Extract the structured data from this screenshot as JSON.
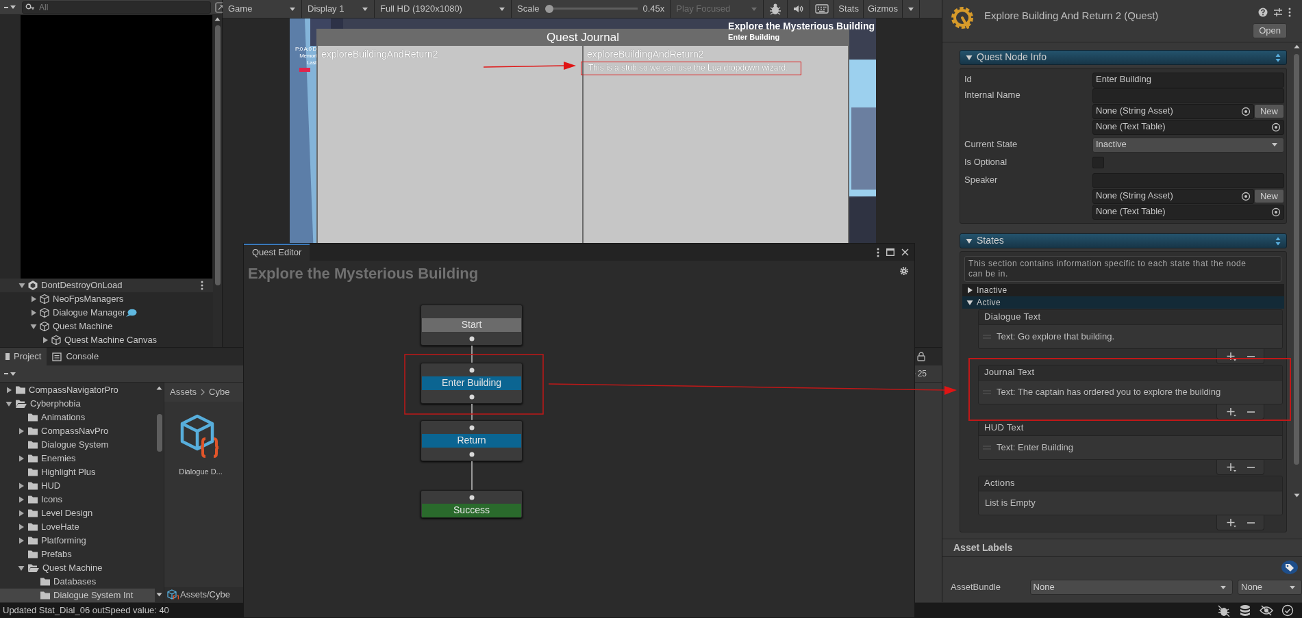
{
  "hierarchy": {
    "search_placeholder": "All",
    "items": [
      {
        "label": "DontDestroyOnLoad",
        "kind": "scene",
        "expanded": true,
        "children": [
          {
            "label": "NeoFpsManagers",
            "kind": "object",
            "expanded": false
          },
          {
            "label": "Dialogue Manager",
            "kind": "dialogue_object",
            "expanded": false
          },
          {
            "label": "Quest Machine",
            "kind": "object",
            "expanded": true,
            "children": [
              {
                "label": "Quest Machine Canvas",
                "kind": "object",
                "expanded": false
              }
            ]
          }
        ]
      }
    ]
  },
  "game_toolbar": {
    "view": "Game",
    "display": "Display 1",
    "resolution": "Full HD (1920x1080)",
    "scale_label": "Scale",
    "scale": {
      "level": 0
    },
    "scale_value": "0.45x",
    "play_mode": "Play Focused",
    "stats": "Stats",
    "gizmos": "Gizmos"
  },
  "game_view": {
    "hud_lines": [
      "P:0 A:0 D",
      "Memori",
      "Last"
    ],
    "tracker_title": "Explore the Mysterious Building",
    "tracker_objective": "Enter Building",
    "journal": {
      "title": "Quest Journal",
      "quests": [
        "exploreBuildingAndReturn2"
      ],
      "detail_heading": "exploreBuildingAndReturn2",
      "detail_text": "This is a stub so we can use the Lua dropdown wizard."
    }
  },
  "project": {
    "tabs": [
      {
        "label": "Project",
        "selected": true
      },
      {
        "label": "Console",
        "selected": false
      }
    ],
    "item_count": "25",
    "folders": [
      {
        "label": "CompassNavigatorPro",
        "expanded": false,
        "selected": false
      },
      {
        "label": "Cyberphobia",
        "expanded": true,
        "selected": false,
        "children": [
          {
            "label": "Animations",
            "selected": false
          },
          {
            "label": "CompassNavPro",
            "expanded": false,
            "selected": false
          },
          {
            "label": "Dialogue System",
            "selected": false
          },
          {
            "label": "Enemies",
            "expanded": false,
            "selected": false
          },
          {
            "label": "Highlight Plus",
            "selected": false
          },
          {
            "label": "HUD",
            "expanded": false,
            "selected": false
          },
          {
            "label": "Icons",
            "expanded": false,
            "selected": false
          },
          {
            "label": "Level Design",
            "expanded": false,
            "selected": false
          },
          {
            "label": "LoveHate",
            "expanded": false,
            "selected": false
          },
          {
            "label": "Platforming",
            "expanded": false,
            "selected": false
          },
          {
            "label": "Prefabs",
            "selected": false
          },
          {
            "label": "Quest Machine",
            "expanded": true,
            "selected": false,
            "children": [
              {
                "label": "Databases",
                "selected": false
              },
              {
                "label": "Dialogue System Int",
                "selected": true
              }
            ]
          }
        ]
      }
    ],
    "breadcrumb": [
      "Assets",
      "Cybe"
    ],
    "assets": [
      {
        "label": "Dialogue D..."
      }
    ],
    "selected_path": "Assets/Cybe"
  },
  "quest_editor": {
    "tab": "Quest Editor",
    "title": "Explore the Mysterious Building",
    "nodes": [
      {
        "label": "Start",
        "kind": "start"
      },
      {
        "label": "Enter Building",
        "kind": "active"
      },
      {
        "label": "Return",
        "kind": "active"
      },
      {
        "label": "Success",
        "kind": "success"
      }
    ]
  },
  "inspector": {
    "title": "Explore Building And Return 2 (Quest)",
    "open_button": "Open",
    "node_info": {
      "heading": "Quest Node Info",
      "expanded": true,
      "fields": [
        {
          "kind": "text",
          "label": "Id",
          "value": "Enter Building"
        },
        {
          "kind": "string_field",
          "label": "Internal Name",
          "string_asset": "None (String Asset)",
          "new_button": "New",
          "text_table": "None (Text Table)"
        },
        {
          "kind": "dropdown",
          "label": "Current State",
          "value": "Inactive"
        },
        {
          "kind": "checkbox",
          "label": "Is Optional",
          "checked": false
        },
        {
          "kind": "string_field",
          "label": "Speaker",
          "string_asset": "None (String Asset)",
          "new_button": "New",
          "text_table": "None (Text Table)"
        }
      ]
    },
    "states": {
      "heading": "States",
      "expanded": true,
      "help": "This section contains information specific to each state that the node can be in.",
      "foldouts": [
        {
          "label": "Inactive",
          "expanded": false
        },
        {
          "label": "Active",
          "expanded": true,
          "lists": [
            {
              "heading": "Dialogue Text",
              "items": [
                "Text: Go explore that building."
              ]
            },
            {
              "heading": "Journal Text",
              "items": [
                "Text: The captain has ordered you to explore the building"
              ]
            },
            {
              "heading": "HUD Text",
              "items": [
                "Text: Enter Building"
              ]
            },
            {
              "heading": "Actions",
              "empty_text": "List is Empty"
            }
          ]
        }
      ]
    },
    "asset_labels": {
      "heading": "Asset Labels",
      "bundle_label": "AssetBundle",
      "bundle": "None",
      "variant": "None"
    }
  },
  "status_bar": {
    "message": "Updated Stat_Dial_06 outSpeed value: 40"
  }
}
